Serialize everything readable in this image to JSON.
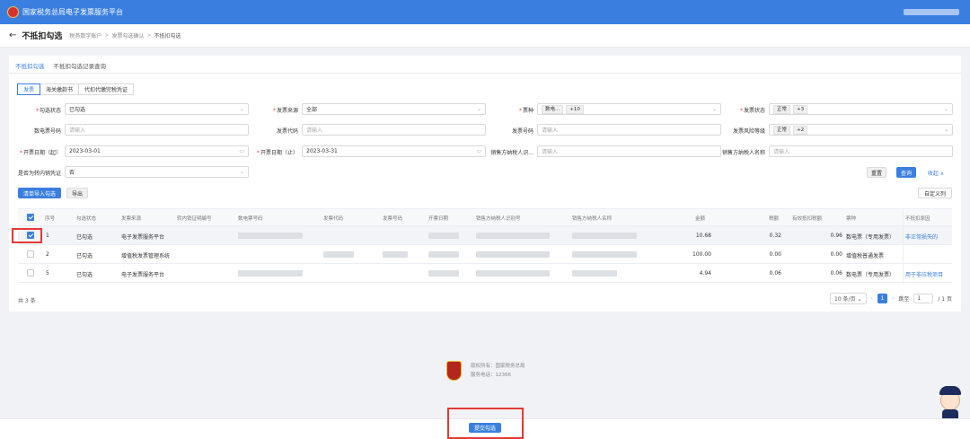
{
  "app": {
    "title": "国家税务总局电子发票服务平台"
  },
  "header": {
    "back_icon": "arrow-left-icon",
    "back_glyph": "←",
    "page_title": "不抵扣勾选",
    "breadcrumb": [
      "税务数字账户",
      "发票勾选确认",
      "不抵扣勾选"
    ],
    "separator": ">"
  },
  "tabs": [
    "不抵扣勾选",
    "不抵扣勾选记录查询"
  ],
  "subtabs": [
    "发票",
    "海关缴款书",
    "代扣代缴完税凭证"
  ],
  "filters": {
    "gxzt": {
      "label": "勾选状态",
      "value": "已勾选"
    },
    "fply": {
      "label": "发票来源",
      "value": "全部"
    },
    "pz": {
      "label": "票种",
      "chips": [
        "数电...",
        "+10"
      ]
    },
    "fpzt": {
      "label": "发票状态",
      "chips": [
        "正常",
        "+3"
      ]
    },
    "sdph": {
      "label": "数电票号码",
      "placeholder": "请输入"
    },
    "fpdm": {
      "label": "发票代码",
      "placeholder": "请输入"
    },
    "fphm": {
      "label": "发票号码",
      "placeholder": "请输入"
    },
    "fxdj": {
      "label": "发票风险等级",
      "chips": [
        "正常",
        "+2"
      ]
    },
    "kprq_start": {
      "label": "开票日期（起）",
      "value": "2023-03-01"
    },
    "kprq_end": {
      "label": "开票日期（止）",
      "value": "2023-03-31"
    },
    "xfsbh": {
      "label": "销售方纳税人识...",
      "placeholder": "请输入"
    },
    "xfmc": {
      "label": "销售方纳税人名称",
      "placeholder": "请输入"
    },
    "sfzz": {
      "label": "是否为转内销凭证",
      "value": "否"
    }
  },
  "buttons": {
    "reset": "重置",
    "query": "查询",
    "collapse": "收起 ∧",
    "import": "清单导入勾选",
    "export": "导出",
    "custom_cols": "自定义列",
    "confirm": "提交勾选"
  },
  "table": {
    "headers": [
      "序号",
      "勾选状态",
      "发票来源",
      "转内销证明编号",
      "数电票号码",
      "发票代码",
      "发票号码",
      "开票日期",
      "销售方纳税人识别号",
      "销售方纳税人名称",
      "金额",
      "税额",
      "有效抵扣税额",
      "票种",
      "不抵扣原因"
    ],
    "rows": [
      {
        "checked": true,
        "no": "1",
        "status": "已勾选",
        "source": "电子发票服务平台",
        "amount": "10.68",
        "tax": "0.32",
        "valid_tax": "0.96",
        "type": "数电票（专用发票）",
        "reason": "非正常损失的"
      },
      {
        "checked": false,
        "no": "2",
        "status": "已勾选",
        "source": "增值税发票管理系统",
        "amount": "100.00",
        "tax": "0.00",
        "valid_tax": "0.00",
        "type": "增值税普通发票",
        "reason": ""
      },
      {
        "checked": false,
        "no": "5",
        "status": "已勾选",
        "source": "电子发票服务平台",
        "amount": "4.94",
        "tax": "0.06",
        "valid_tax": "0.06",
        "type": "数电票（专用发票）",
        "reason": "用于非应税项目"
      }
    ]
  },
  "pagination": {
    "total": "共 3 条",
    "page_size": "10 条/页",
    "page": "1",
    "goto_label": "跳至",
    "goto_value": "1",
    "pages": "/ 1 页",
    "prev_glyph": "‹",
    "next_glyph": "›"
  },
  "footer": {
    "host": "版权所有：国家税务总局",
    "phone": "服务电话：12366"
  }
}
